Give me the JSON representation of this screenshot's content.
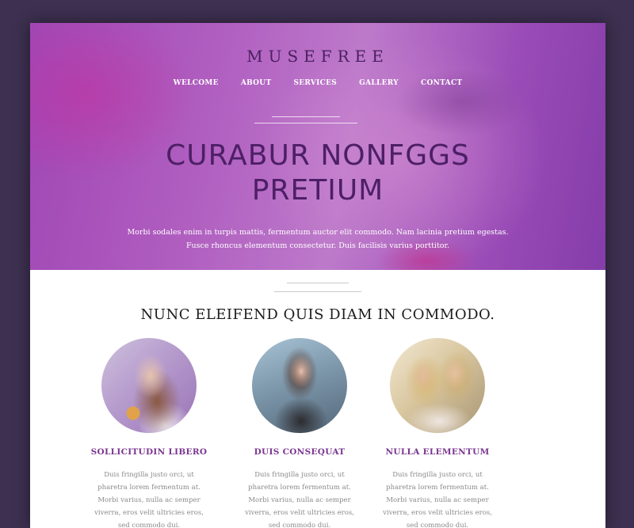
{
  "brand": "MUSEFREE",
  "nav": [
    "WELCOME",
    "ABOUT",
    "SERVICES",
    "GALLERY",
    "CONTACT"
  ],
  "hero": {
    "headline_line1": "CURABUR NONFGGS",
    "headline_line2": "PRETIUM",
    "text_line1": "Morbi sodales enim in turpis mattis, fermentum auctor elit commodo. Nam lacinia pretium egestas.",
    "text_line2": "Fusce rhoncus elementum consectetur. Duis facilisis varius porttitor."
  },
  "section": {
    "title": "NUNC ELEIFEND QUIS DIAM IN COMMODO."
  },
  "features": [
    {
      "title": "SOLLICITUDIN LIBERO",
      "text": "Duis fringilla justo orci, ut pharetra lorem fermentum at. Morbi varius, nulla ac semper viverra, eros velit ultricies eros, sed commodo dui."
    },
    {
      "title": "DUIS CONSEQUAT",
      "text": "Duis fringilla justo orci, ut pharetra lorem fermentum at. Morbi varius, nulla ac semper viverra, eros velit ultricies eros, sed commodo dui."
    },
    {
      "title": "NULLA ELEMENTUM",
      "text": "Duis fringilla justo orci, ut pharetra lorem fermentum at. Morbi varius, nulla ac semper viverra, eros velit ultricies eros, sed commodo dui."
    }
  ],
  "colors": {
    "outer_background": "#3d3050",
    "hero_purple": "#a347b6",
    "headline": "#4d1f66",
    "feature_title": "#7a3590",
    "body_text": "#8a8a8a"
  }
}
